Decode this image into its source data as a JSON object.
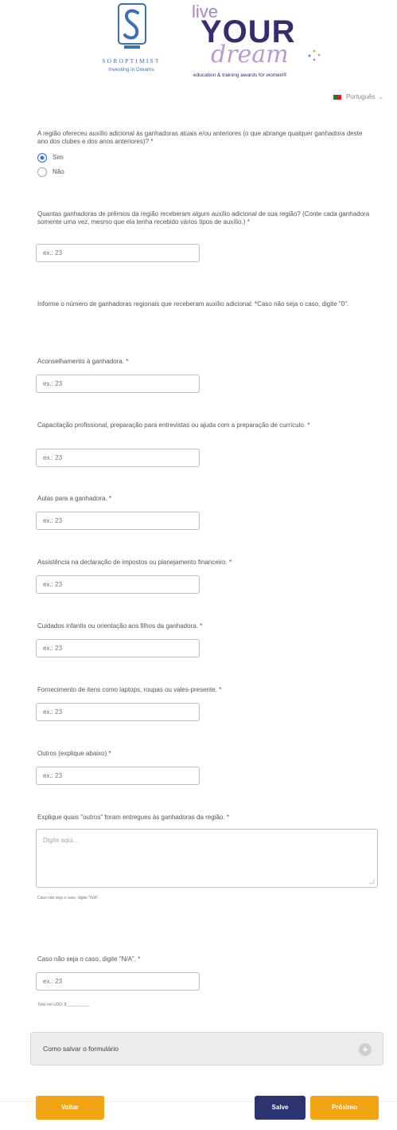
{
  "header": {
    "soroptimist_name": "SOROPTIMIST",
    "soroptimist_tagline": "Investing in Dreams",
    "lyd_live": "live",
    "lyd_your": "YOUR",
    "lyd_dream": "dream",
    "lyd_subtitle": "education & training awards for women®"
  },
  "language": {
    "label": "Português"
  },
  "questions": {
    "q1": {
      "text": "A região ofereceu auxílio adicional às ganhadoras atuais e/ou anteriores (o que abrange qualquer ganhadora deste ano dos clubes e dos anos anteriores)? *"
    },
    "radio_options": [
      {
        "label": "Sim",
        "checked": true
      },
      {
        "label": "Não",
        "checked": false
      }
    ],
    "q2": {
      "text": "Quantas ganhadoras de prêmios da região receberam algum auxílio adicional de sua região? (Conte cada ganhadora somente uma vez, mesmo que ela tenha recebido vários tipos de auxílio.) *"
    },
    "info": "Informe o número de ganhadoras regionais que receberam auxílio adicional: *Caso não seja o caso, digite \"0\".",
    "q3": {
      "text": "Aconselhamento à ganhadora. *"
    },
    "q4": {
      "text": "Capacitação profissional, preparação para entrevistas ou ajuda com a preparação de currículo. *"
    },
    "q5": {
      "text": "Aulas para a ganhadora. *"
    },
    "q6": {
      "text": "Assistência na declaração de impostos ou planejamento financeiro. *"
    },
    "q7": {
      "text": "Cuidados infantis ou orientação aos filhos da ganhadora. *"
    },
    "q8": {
      "text": "Fornecimento de itens como laptops, roupas ou vales-presente. *"
    },
    "q9": {
      "text": "Outros (explique abaixo) *"
    },
    "q10": {
      "text": "Explique quais \"outros\" foram entregues às ganhadoras da região. *"
    },
    "q10_note": "Caso não seja o caso, digite \"N/A\".",
    "q11": {
      "text": "Caso não seja o caso, digite \"N/A\". *"
    },
    "q11_note": "Total em USD: $ __________"
  },
  "inputs": {
    "placeholder": "ex.: 23",
    "textarea_placeholder": "Digite aqui..."
  },
  "accordion": {
    "title": "Como salvar o formulário",
    "toggle": "+"
  },
  "buttons": {
    "back": "Voltar",
    "save": "Salve",
    "next": "Próximo"
  }
}
